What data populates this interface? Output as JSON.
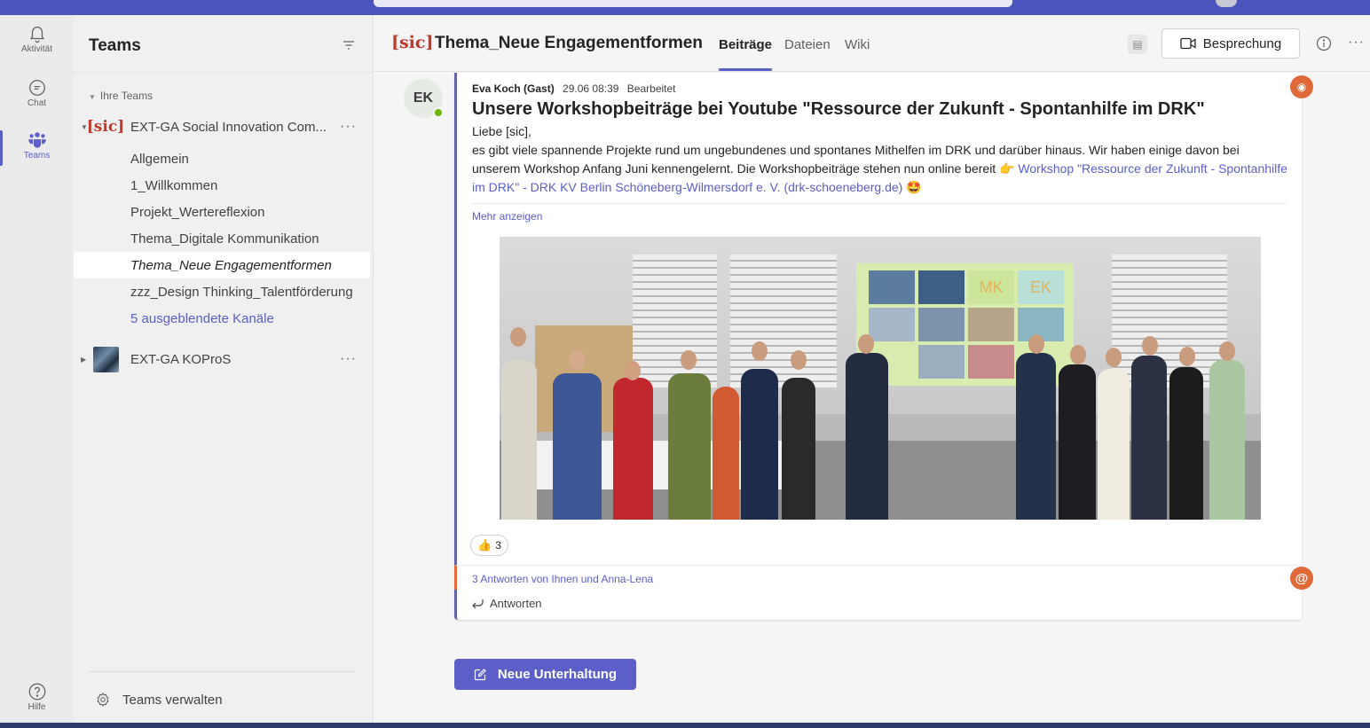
{
  "rail": {
    "activity_label": "Aktivität",
    "chat_label": "Chat",
    "teams_label": "Teams",
    "help_label": "Hilfe"
  },
  "panel": {
    "title": "Teams",
    "section_label": "Ihre Teams",
    "teams": [
      {
        "logo_text": "[sic]",
        "name": "EXT-GA Social Innovation Com...",
        "channels": [
          {
            "name": "Allgemein"
          },
          {
            "name": "1_Willkommen"
          },
          {
            "name": "Projekt_Wertereflexion"
          },
          {
            "name": "Thema_Digitale Kommunikation"
          },
          {
            "name": "Thema_Neue Engagementformen",
            "active": true
          },
          {
            "name": "zzz_Design Thinking_Talentförderung"
          }
        ],
        "hidden_channels": "5 ausgeblendete Kanäle"
      },
      {
        "name": "EXT-GA KOProS"
      }
    ],
    "more_glyph": "···",
    "manage_label": "Teams verwalten"
  },
  "header": {
    "logo_text": "[sic]",
    "channel_title": "Thema_Neue Engagementformen",
    "tabs": [
      {
        "label": "Beiträge",
        "active": true
      },
      {
        "label": "Dateien"
      },
      {
        "label": "Wiki"
      }
    ],
    "meeting_button": "Besprechung",
    "more_glyph": "···"
  },
  "post": {
    "avatar_initials": "EK",
    "author": "Eva Koch (Gast)",
    "time": "29.06 08:39",
    "edited": "Bearbeitet",
    "heading": "Unsere Workshopbeiträge bei Youtube \"Ressource der Zukunft - Spontanhilfe im DRK\"",
    "greeting": "Liebe [sic],",
    "body_text": "es gibt viele spannende Projekte rund um ungebundenes und spontanes Mithelfen im DRK und darüber hinaus. Wir haben einige davon bei unserem Workshop Anfang Juni kennengelernt. Die Workshopbeiträge stehen nun online bereit",
    "emoji_point": "👉",
    "link_text": "Workshop \"Ressource der Zukunft - Spontanhilfe im DRK\" - DRK KV Berlin Schöneberg-Wilmersdorf e. V. (drk-schoeneberg.de)",
    "emoji_star": "🤩",
    "more_label": "Mehr anzeigen",
    "photo_tile_1": "MK",
    "photo_tile_2": "EK",
    "reaction_count": "3",
    "replies_label": "3 Antworten von Ihnen und Anna-Lena",
    "reply_label": "Antworten"
  },
  "new_conversation": "Neue Unterhaltung",
  "colors": {
    "brand": "#5b5fc7",
    "header_bar": "#4b53bc",
    "sic_red": "#c0392b",
    "mention_orange": "#e0693a"
  }
}
